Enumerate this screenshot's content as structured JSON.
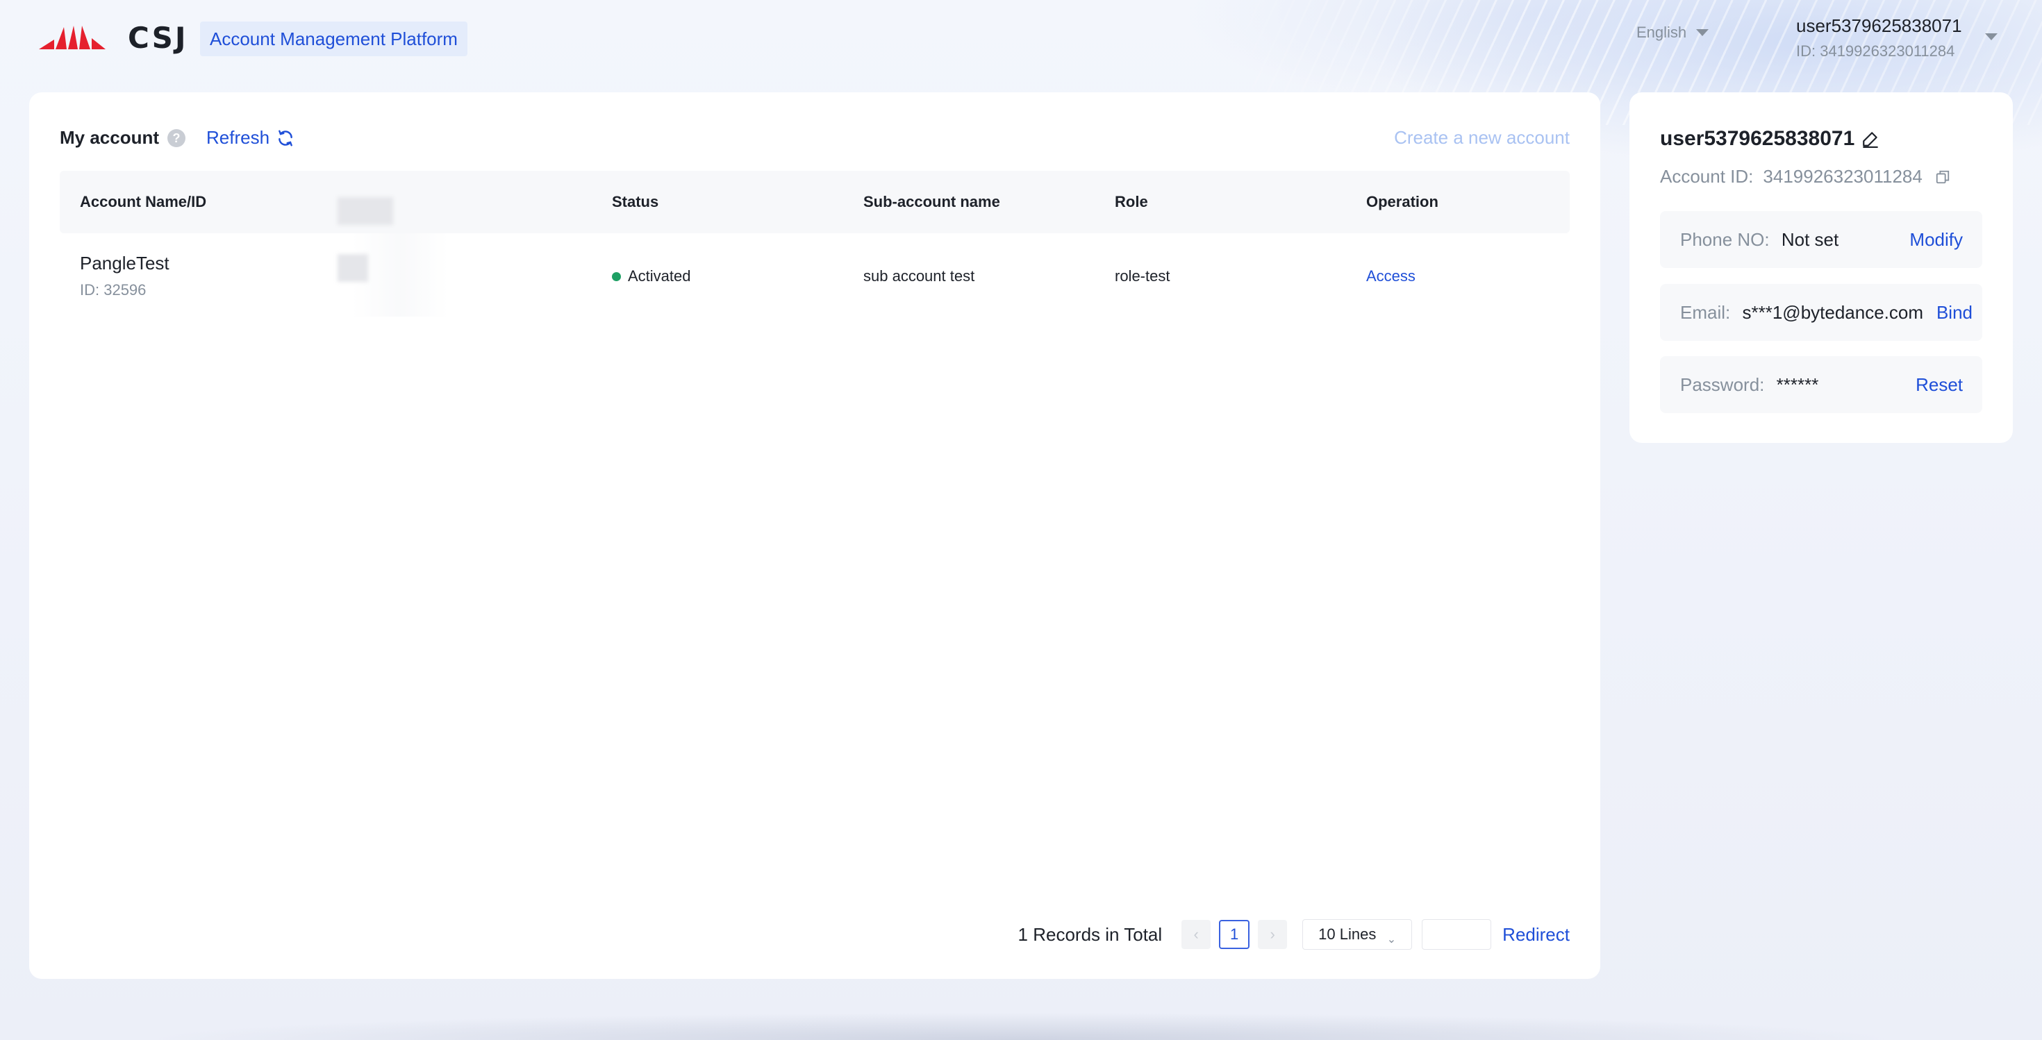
{
  "header": {
    "logo_text": "CSJ",
    "platform_title": "Account Management Platform",
    "language": "English",
    "user_name": "user5379625838071",
    "user_id": "ID: 3419926323011284"
  },
  "main": {
    "title": "My account",
    "help_symbol": "?",
    "refresh_label": "Refresh",
    "create_label": "Create a new account",
    "columns": {
      "name": "Account Name/ID",
      "status": "Status",
      "sub_account": "Sub-account name",
      "role": "Role",
      "operation": "Operation"
    },
    "rows": [
      {
        "name": "PangleTest",
        "id": "ID: 32596",
        "status": "Activated",
        "sub_account": "sub account test",
        "role": "role-test",
        "operation": "Access"
      }
    ],
    "pagination": {
      "total": "1 Records in Total",
      "prev": "‹",
      "page": "1",
      "next": "›",
      "lines": "10 Lines",
      "jump_value": "",
      "redirect": "Redirect"
    }
  },
  "side": {
    "user_name": "user5379625838071",
    "account_id_label": "Account ID:",
    "account_id": "3419926323011284",
    "phone_label": "Phone NO:",
    "phone_value": "Not set",
    "phone_action": "Modify",
    "email_label": "Email:",
    "email_value": "s***1@bytedance.com",
    "email_action": "Bind",
    "password_label": "Password:",
    "password_value": "******",
    "password_action": "Reset"
  },
  "colors": {
    "accent": "#1f4fd8",
    "brand_red": "#e5202e",
    "status_active": "#1ea064"
  },
  "icons": [
    "csj-logo-icon",
    "help-icon",
    "refresh-icon",
    "caret-down-icon",
    "edit-icon",
    "copy-icon",
    "chevron-down-icon"
  ]
}
